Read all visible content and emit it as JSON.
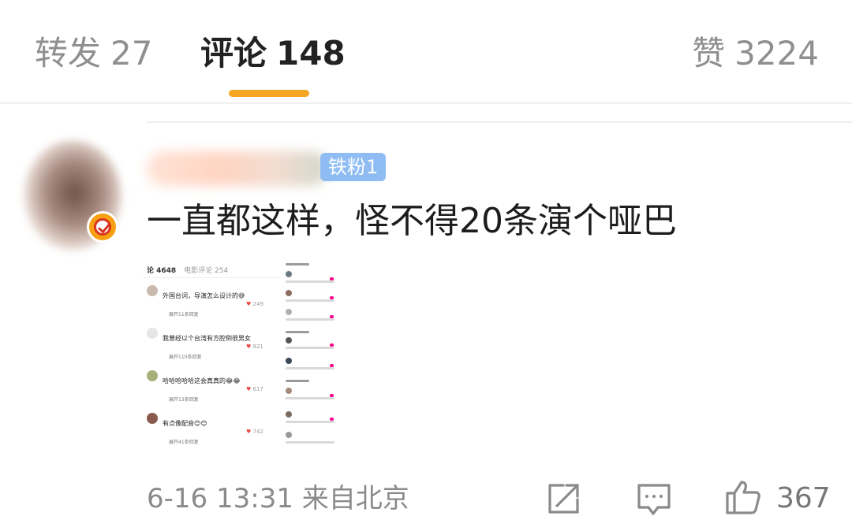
{
  "tabs": {
    "repost": {
      "label": "转发",
      "count": "27"
    },
    "comments": {
      "label": "评论",
      "count": "148"
    },
    "likes": {
      "label": "赞",
      "count": "3224"
    }
  },
  "comment": {
    "fan_badge": "铁粉1",
    "text": "一直都这样，怪不得20条演个哑巴",
    "timestamp": "6-16 13:31",
    "source": "来自北京",
    "like_count": "367"
  },
  "embedded_screenshot": {
    "tabs": [
      "论 4648",
      "电影评论 254"
    ],
    "comments": [
      {
        "text": "外国台词，导演怎么设计的😅",
        "likes": "249",
        "replies": "展开11条回复"
      },
      {
        "text": "我曾经以个台湾有方腔倒很男女",
        "likes": "921",
        "replies": "展开110条回复"
      },
      {
        "text": "哈哈哈哈哈这会真真的😂😂",
        "likes": "617",
        "replies": "展开13条回复"
      },
      {
        "text": "有点像配音😊😊",
        "likes": "742",
        "replies": "展开41条回复"
      }
    ]
  },
  "colors": {
    "tab_indicator": "#f5a623",
    "fan_badge_bg": "#8fbdf3",
    "verified": "#f7a012"
  },
  "icons": [
    "share-icon",
    "comment-icon",
    "like-icon",
    "verified-badge-icon"
  ]
}
